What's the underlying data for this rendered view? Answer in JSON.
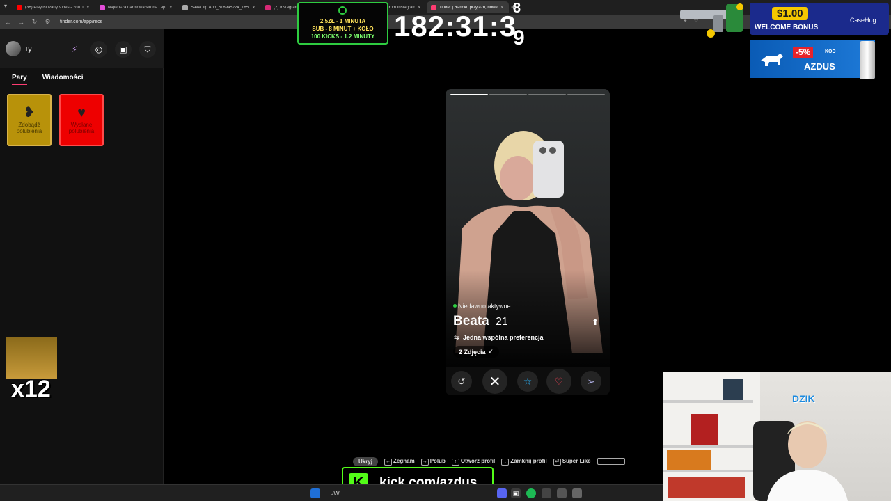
{
  "browser": {
    "tabs": [
      {
        "title": "(36) Playlist Party Vibes - YouTube",
        "color": "#ff0000"
      },
      {
        "title": "Najlepsza darmowa strona i ap...",
        "color": "#e44dd9"
      },
      {
        "title": "SaveClip.App_618945224_185...",
        "color": "#aaaaaa"
      },
      {
        "title": "(2) Instagram",
        "color": "#d62976"
      },
      {
        "title": "Download photo from Instagram",
        "color": "#8a3ffc"
      },
      {
        "title": "Tinder | Randki, przyjaźń, nowe...",
        "color": "#fe3c72"
      }
    ],
    "url": "tinder.com/app/recs"
  },
  "sidebar": {
    "you_label": "Ty",
    "tabs": {
      "matches": "Pary",
      "messages": "Wiadomości"
    },
    "tiles": {
      "get_likes": "Zdobądź polubienia",
      "sent_likes": "Wysłane polubienia"
    }
  },
  "promo": {
    "line1": "2.5ZŁ - 1 MINUTA",
    "line2": "SUB - 8 MINUT + KOŁO",
    "line3": "100 KICKS - 1.2 MINUTY"
  },
  "timer": {
    "main": "182:31:3",
    "digit_top": "8",
    "digit_bottom": "9"
  },
  "casino_ad": {
    "amount": "$1.00",
    "text": "WELCOME BONUS",
    "brand": "CaseHug"
  },
  "dzik_ad": {
    "discount": "-5%",
    "code_label": "KOD",
    "code": "AZDUS",
    "can_text": "DZIK"
  },
  "profile": {
    "status": "Niedawno aktywne",
    "name": "Beata",
    "age": "21",
    "preference": "Jedna wspólna preferencja",
    "photos": "2 Zdjęcia",
    "photo_count": 4,
    "photo_index": 1
  },
  "hints": {
    "hide": "Ukryj",
    "nope": "Żegnam",
    "like": "Polub",
    "open": "Otwórz profil",
    "close": "Zamknij profil",
    "super": "Super Like"
  },
  "kick": {
    "logo": "K",
    "url": "kick.com/azdus"
  },
  "emote": {
    "count": "x12"
  },
  "webcam": {
    "logo": "DZIK"
  },
  "taskbar": {
    "search": "W"
  },
  "colors": {
    "tinder": "#fe3c72",
    "kick": "#53fc18",
    "like": "#ff4458",
    "super": "#2ab6ff"
  }
}
